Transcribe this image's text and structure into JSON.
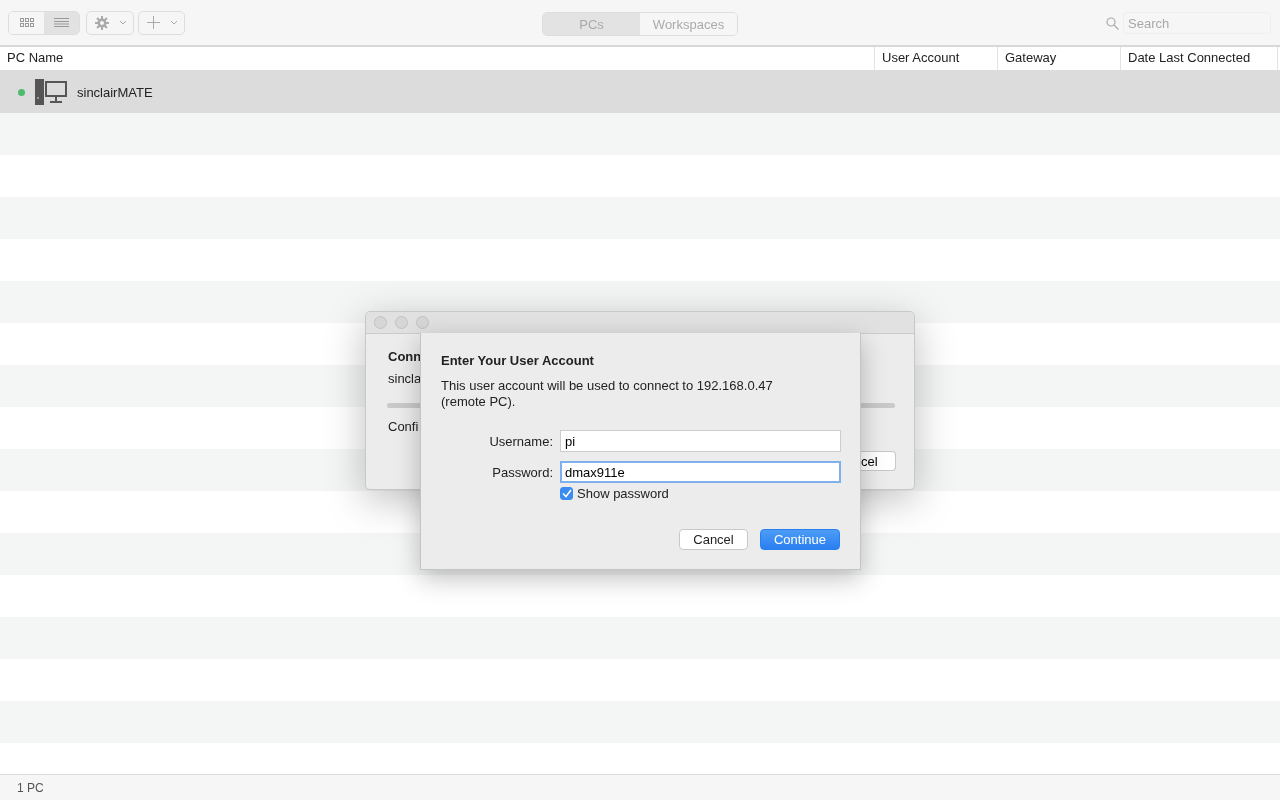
{
  "toolbar": {
    "view_buttons": [
      {
        "kind": "grid",
        "selected": false
      },
      {
        "kind": "list",
        "selected": true
      }
    ],
    "tabs": [
      {
        "label": "PCs",
        "selected": true
      },
      {
        "label": "Workspaces",
        "selected": false
      }
    ],
    "search": {
      "placeholder": "Search"
    }
  },
  "table": {
    "columns": [
      "PC Name",
      "User Account",
      "Gateway",
      "Date Last Connected"
    ],
    "rows": [
      {
        "name": "sinclairMATE",
        "online": true,
        "selected": true
      }
    ]
  },
  "background_dialog": {
    "title": "Conn",
    "subtitle": "sincla",
    "progress": {
      "level": 1
    },
    "status": "Confi",
    "button": "cel"
  },
  "sheet": {
    "title": "Enter Your User Account",
    "message": "This user account will be used to connect to 192.168.0.47 (remote PC).",
    "fields": [
      {
        "label": "Username:",
        "value": "pi",
        "focused": false
      },
      {
        "label": "Password:",
        "value": "dmax911e",
        "focused": true
      }
    ],
    "show_password": {
      "label": "Show password",
      "checked": true
    },
    "buttons": [
      {
        "label": "Cancel",
        "kind": "secondary"
      },
      {
        "label": "Continue",
        "kind": "primary"
      }
    ]
  },
  "status_bar": "1 PC"
}
